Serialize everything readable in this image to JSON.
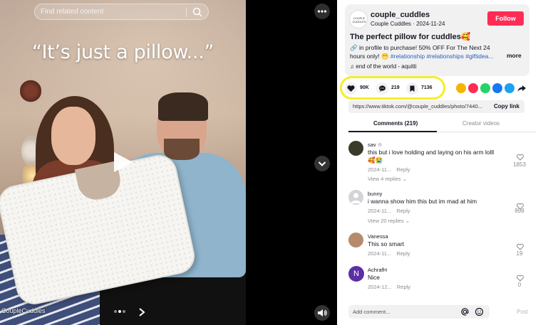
{
  "video": {
    "search_placeholder": "Find related content",
    "caption": "“It’s just a pillow...”",
    "watermark": "CoupleCuddles"
  },
  "author": {
    "avatar_text": "COUPLE CUDDLES",
    "username": "couple_cuddles",
    "display_name": "Couple Cuddles",
    "date": "2024-11-24",
    "follow_label": "Follow"
  },
  "post": {
    "title": "The perfect pillow for cuddles🥰",
    "desc_text": "🔗 in profile to purchase! 50% OFF For The Next 24 hours only! 😁 ",
    "desc_tags": "#relationship #relationships #giftidea...",
    "more_label": "more",
    "music": "♫  end of the world - aquitti"
  },
  "stats": {
    "likes": "90K",
    "comments": "219",
    "saves": "7136"
  },
  "share_colors": [
    "#f5b400",
    "#fe2c55",
    "#25d366",
    "#1877f2",
    "#1da1f2"
  ],
  "link": {
    "url": "https://www.tiktok.com/@couple_cuddles/photo/7440...",
    "copy_label": "Copy link"
  },
  "tabs": {
    "comments": "Comments (219)",
    "creator_videos": "Creator videos"
  },
  "comments": [
    {
      "name": "sav ☆",
      "text": "this but i love holding and laying on his arm lolll🥰😭",
      "date": "2024-11...",
      "reply": "Reply",
      "replies": "View 4 replies ⌄",
      "likes": "1853",
      "avatar_color": "#3a3a2a"
    },
    {
      "name": "bunny",
      "text": "i wanna show him this but im mad at him",
      "date": "2024-11...",
      "reply": "Reply",
      "replies": "View 20 replies ⌄",
      "likes": "898",
      "avatar_color": "#d4d4d8"
    },
    {
      "name": "Vanessa",
      "text": "This so smart",
      "date": "2024-11...",
      "reply": "Reply",
      "likes": "19",
      "avatar_color": "#b58b6b"
    },
    {
      "name": "AchrafH",
      "text": "Nice",
      "date": "2024-12...",
      "reply": "Reply",
      "likes": "0",
      "avatar_color": "#5b2ea6",
      "avatar_letter": "N"
    }
  ],
  "composer": {
    "placeholder": "Add comment...",
    "post_label": "Post"
  }
}
